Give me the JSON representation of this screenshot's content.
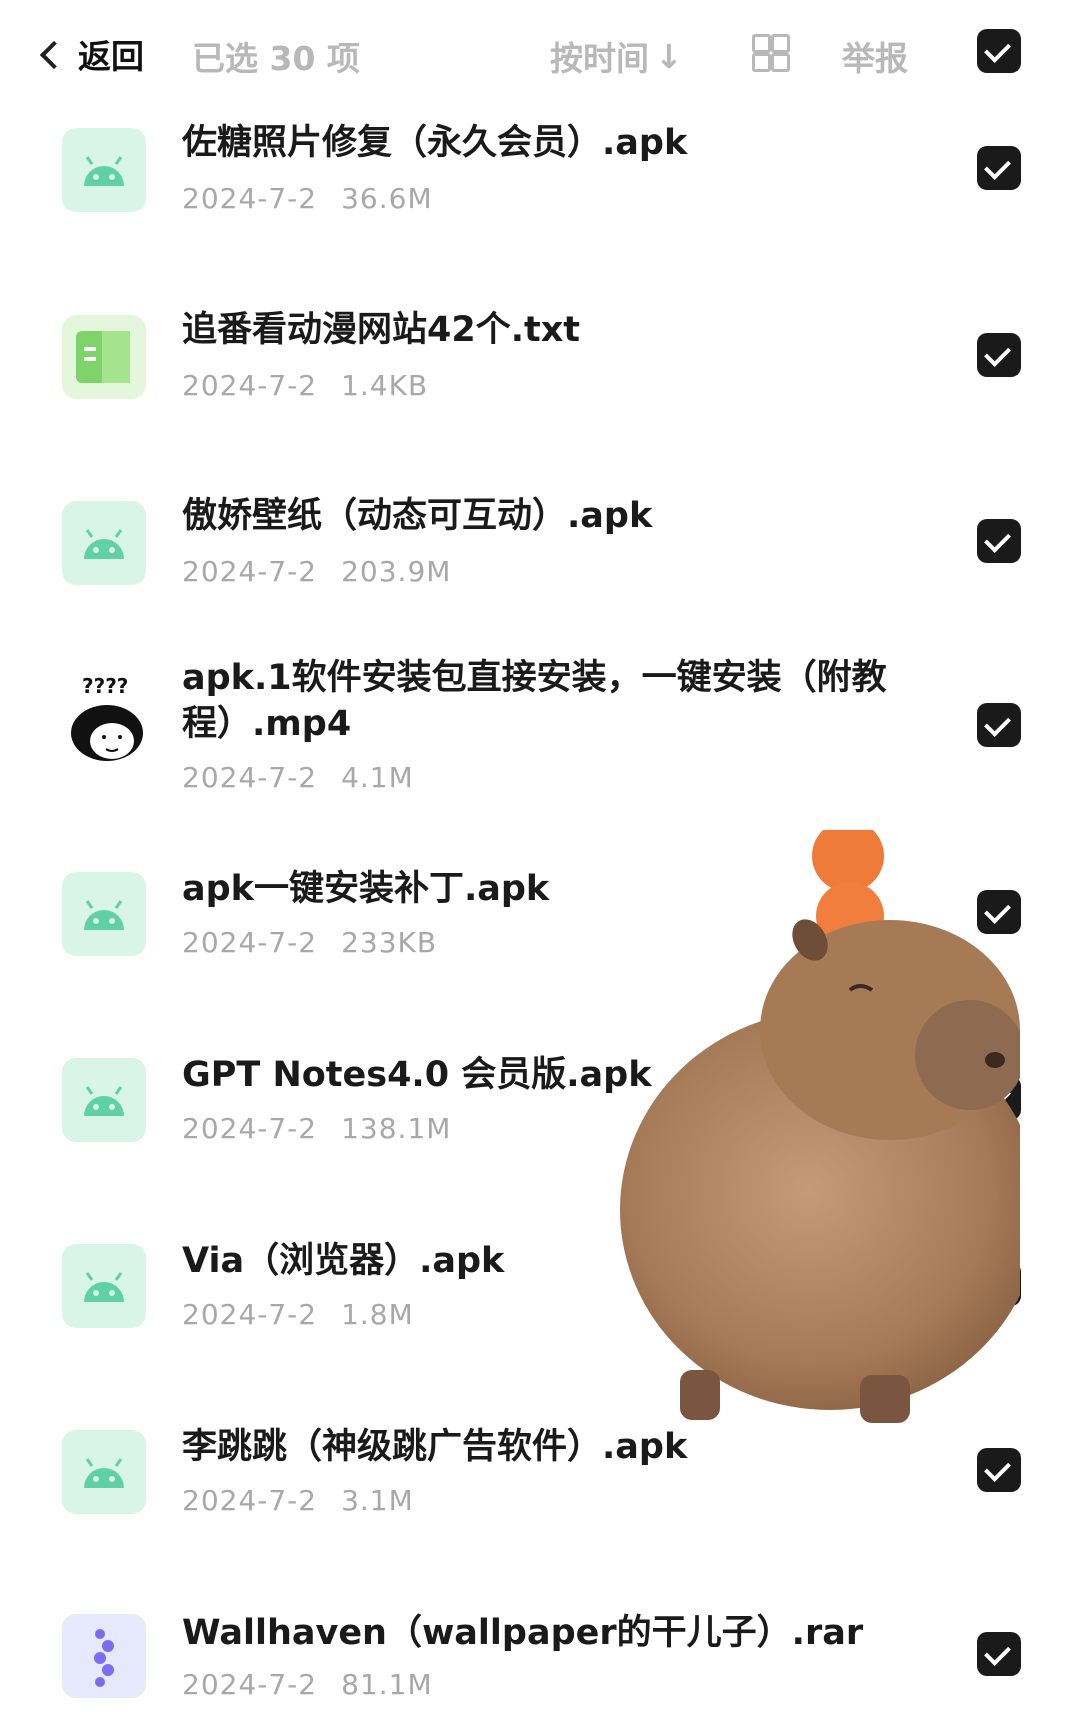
{
  "header": {
    "back_label": "返回",
    "selected_text": "已选 30 项",
    "sort_label": "按时间",
    "sort_arrow": "↓",
    "report_label": "举报"
  },
  "files": [
    {
      "name": "佐糖照片修复（永久会员）.apk",
      "date": "2024-7-2",
      "size": "36.6M",
      "icon": "android-icon",
      "checked": true
    },
    {
      "name": "追番看动漫网站42个.txt",
      "date": "2024-7-2",
      "size": "1.4KB",
      "icon": "text-file-icon",
      "checked": true
    },
    {
      "name": "傲娇壁纸（动态可互动）.apk",
      "date": "2024-7-2",
      "size": "203.9M",
      "icon": "android-icon",
      "checked": true
    },
    {
      "name": "apk.1软件安装包直接安装，一键安装（附教程）.mp4",
      "date": "2024-7-2",
      "size": "4.1M",
      "icon": "video-thumbnail",
      "checked": true
    },
    {
      "name": "apk一键安装补丁.apk",
      "date": "2024-7-2",
      "size": "233KB",
      "icon": "android-icon",
      "checked": true
    },
    {
      "name": "GPT Notes4.0 会员版.apk",
      "date": "2024-7-2",
      "size": "138.1M",
      "icon": "android-icon",
      "checked": true
    },
    {
      "name": "Via（浏览器）.apk",
      "date": "2024-7-2",
      "size": "1.8M",
      "icon": "android-icon",
      "checked": true
    },
    {
      "name": "李跳跳（神级跳广告软件）.apk",
      "date": "2024-7-2",
      "size": "3.1M",
      "icon": "android-icon",
      "checked": true
    },
    {
      "name": "Wallhaven（wallpaper的干儿子）.rar",
      "date": "2024-7-2",
      "size": "81.1M",
      "icon": "archive-icon",
      "checked": true
    }
  ],
  "meme_thumbnail_text": "????",
  "colors": {
    "apk_bg": "#d9f5ea",
    "apk_fg": "#5fd0a8",
    "txt_fg": "#7ed36a",
    "rar_fg": "#7b6cf0",
    "checkbox": "#1a1a1a"
  }
}
